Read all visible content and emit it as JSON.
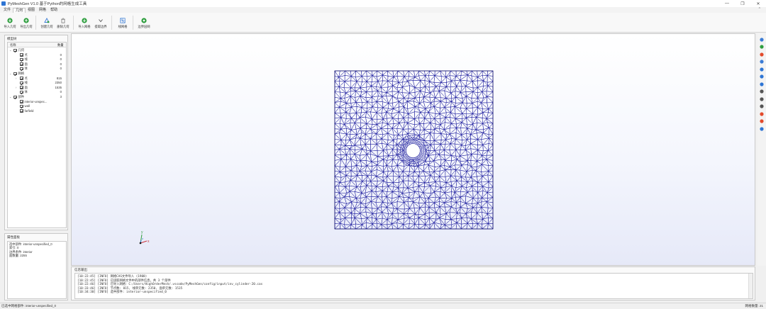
{
  "window": {
    "title": "PyMeshGen V1.0   基于Python的网格生成工具",
    "minimize": "—",
    "maximize": "❐",
    "close": "✕"
  },
  "menu": {
    "tabs": [
      "文件",
      "几何",
      "视图",
      "网格",
      "帮助"
    ],
    "active_index": 1,
    "collapse_glyph": "^"
  },
  "ribbon": {
    "buttons": [
      {
        "label": "导入几何",
        "icon": "import-geometry-icon",
        "color": "#2e9e3e"
      },
      {
        "label": "导出几何",
        "icon": "export-geometry-icon",
        "color": "#2e9e3e"
      },
      {
        "label": "创建几何",
        "icon": "create-geometry-icon",
        "color": "#3a7bd5"
      },
      {
        "label": "删除几何",
        "icon": "delete-geometry-icon",
        "color": "#777777"
      },
      {
        "label": "导入网格",
        "icon": "import-mesh-icon",
        "color": "#2e9e3e"
      },
      {
        "label": "提取边界",
        "icon": "extract-boundary-icon",
        "color": "#555555"
      },
      {
        "label": "线网格",
        "icon": "line-mesh-icon",
        "color": "#2e75d4"
      },
      {
        "label": "边界层网",
        "icon": "boundary-layer-icon",
        "color": "#2e9e3e"
      }
    ]
  },
  "model_tree": {
    "title": "模型树",
    "col_name": "名称",
    "col_count": "数量",
    "rows": [
      {
        "label": "几何",
        "count": "",
        "level": 0,
        "expanded": true
      },
      {
        "label": "点",
        "count": "0",
        "level": 1
      },
      {
        "label": "线",
        "count": "0",
        "level": 1
      },
      {
        "label": "面",
        "count": "0",
        "level": 1
      },
      {
        "label": "体",
        "count": "0",
        "level": 1
      },
      {
        "label": "网格",
        "count": "",
        "level": 0,
        "expanded": true
      },
      {
        "label": "点",
        "count": "815",
        "level": 1,
        "collapsed": true
      },
      {
        "label": "线",
        "count": "2350",
        "level": 1
      },
      {
        "label": "面",
        "count": "1535",
        "level": 1,
        "collapsed": true
      },
      {
        "label": "体",
        "count": "0",
        "level": 1
      },
      {
        "label": "部件",
        "count": "3",
        "level": 0,
        "expanded": true
      },
      {
        "label": "interior-unspec...",
        "count": "",
        "level": 1
      },
      {
        "label": "wall",
        "count": "",
        "level": 1
      },
      {
        "label": "farfield",
        "count": "",
        "level": 1
      }
    ]
  },
  "properties": {
    "title": "属性面板",
    "lines": [
      "选中部件: interior-unspecified_0",
      "索引: 0",
      "边界条件: interior",
      "面数量: 2255"
    ]
  },
  "viewport": {
    "mesh_color": "#1a1a9c",
    "background_top": "#ffffff",
    "background_bottom": "#e6e9f8",
    "axis_labels": {
      "y": "y",
      "x": "x",
      "z": "z"
    }
  },
  "side_toolbar": {
    "icons": [
      {
        "name": "view-fit-icon",
        "color": "#3a7bd5"
      },
      {
        "name": "view-front-icon",
        "color": "#2e9e3e"
      },
      {
        "name": "view-back-icon",
        "color": "#e24a2b"
      },
      {
        "name": "view-top-icon",
        "color": "#3a7bd5"
      },
      {
        "name": "view-bottom-icon",
        "color": "#2e75d4"
      },
      {
        "name": "view-iso-icon",
        "color": "#2e75d4"
      },
      {
        "name": "wireframe-icon",
        "color": "#2e75d4"
      },
      {
        "name": "surface-icon",
        "color": "#555555"
      },
      {
        "name": "axis-x-icon",
        "color": "#555555"
      },
      {
        "name": "axis-y-icon",
        "color": "#555555"
      },
      {
        "name": "red-marker-icon",
        "color": "#e24a2b"
      },
      {
        "name": "orange-marker-icon",
        "color": "#e24a2b"
      },
      {
        "name": "blue-marker-icon",
        "color": "#2e75d4"
      }
    ]
  },
  "log": {
    "title": "信息输出",
    "lines": [
      "[10:22:45] [INFO] 网格CAS文件导入 (1908)",
      "[10:22:45] [INFO] 已读取网格文件中的部件信息，共 3 个部件",
      "[10:22:46] [INFO] 已导入网格：C:/Users/HighOrderMesh/.vscode/PyMeshGen/config/input/inv_cylinder-20.cas",
      "[10:33:46] [INFO] 节点数: 815, 线单元数: 2350, 面单元数: 1535",
      "[10:34:30] [INFO] 选中部件: interior-unspecified_0"
    ]
  },
  "status": {
    "left": "已选中网格部件: interior-unspecified_0",
    "right": "网格数量: 21"
  }
}
